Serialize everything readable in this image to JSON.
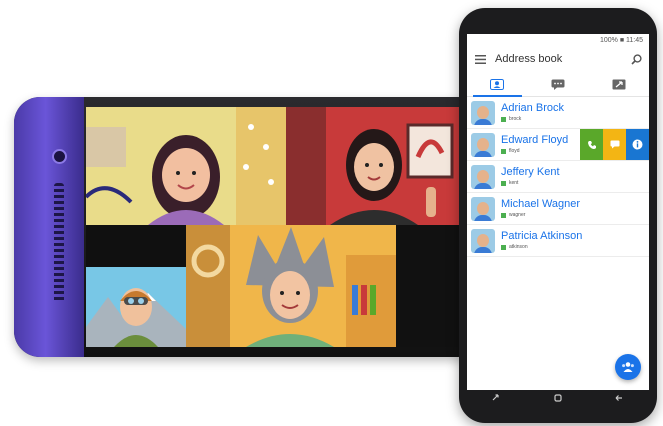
{
  "status_bar": {
    "text": "100% ■ 11:45"
  },
  "app_bar": {
    "title": "Address book"
  },
  "tabs": [
    {
      "name": "contacts",
      "icon": "contact-card-icon",
      "active": true
    },
    {
      "name": "messages",
      "icon": "chat-icon",
      "active": false
    },
    {
      "name": "calls",
      "icon": "call-history-icon",
      "active": false
    }
  ],
  "contacts": [
    {
      "name": "Adrian Brock",
      "username": "brock"
    },
    {
      "name": "Edward Floyd",
      "username": "floyd"
    },
    {
      "name": "Jeffery Kent",
      "username": "kent"
    },
    {
      "name": "Michael Wagner",
      "username": "wagner"
    },
    {
      "name": "Patricia Atkinson",
      "username": "atkinson"
    }
  ],
  "colors": {
    "accent": "#1a73e8",
    "call": "#5aa82a",
    "message": "#f3b514",
    "info": "#1976d2",
    "online": "#4caf50",
    "phone_bezel": "#6a55d8"
  },
  "icons": {
    "menu": "hamburger-icon",
    "search": "search-icon",
    "fab": "group-call-icon",
    "call": "phone-icon",
    "message": "message-icon",
    "info": "info-icon"
  }
}
